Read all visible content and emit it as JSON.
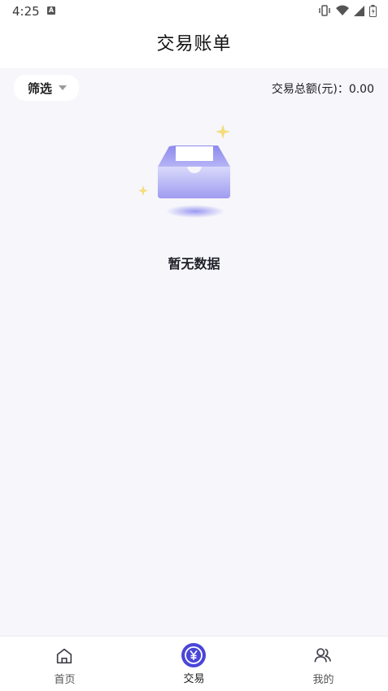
{
  "status_bar": {
    "time": "4:25",
    "notification_icon": "A"
  },
  "header": {
    "title": "交易账单"
  },
  "toolbar": {
    "filter_label": "筛选",
    "total_label": "交易总额(元)：",
    "total_value": "0.00"
  },
  "empty_state": {
    "message": "暂无数据",
    "icon": "empty-box-icon"
  },
  "tab_bar": {
    "items": [
      {
        "label": "首页",
        "icon": "home-icon",
        "active": false
      },
      {
        "label": "交易",
        "icon": "yuan-icon",
        "active": true
      },
      {
        "label": "我的",
        "icon": "users-icon",
        "active": false
      }
    ]
  },
  "colors": {
    "accent": "#4a46d8",
    "background": "#f6f6fb",
    "sparkle": "#f5dc7a"
  }
}
